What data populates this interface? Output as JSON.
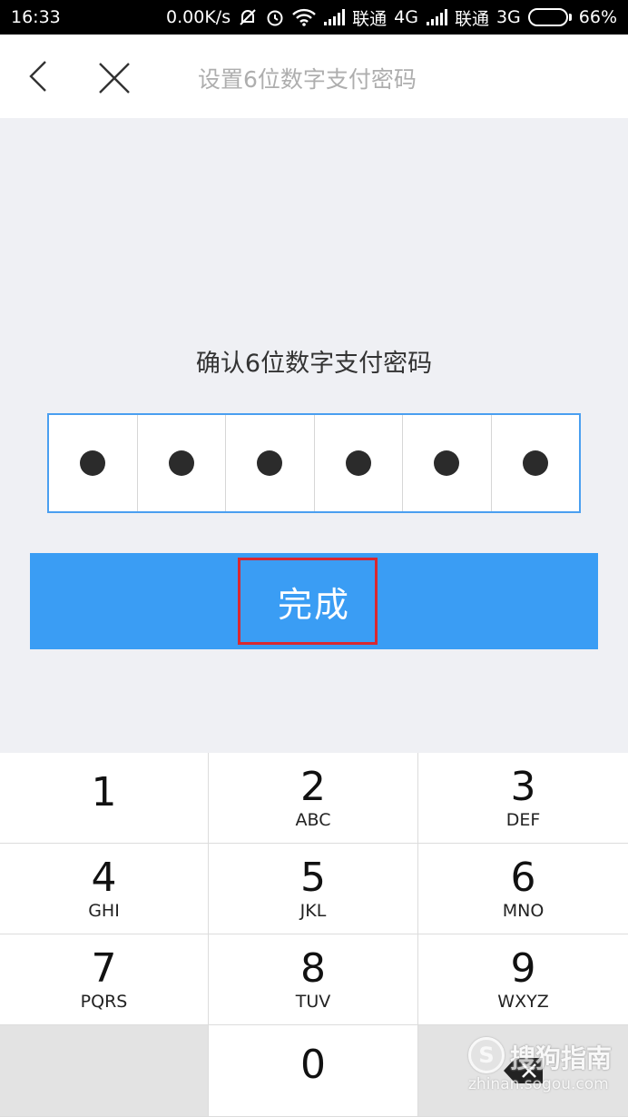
{
  "status_bar": {
    "time": "16:33",
    "net_speed": "0.00K/s",
    "carrier1": "联通",
    "net1": "4G",
    "carrier2": "联通",
    "net2": "3G",
    "battery_text": "66%",
    "battery_level": 0.66
  },
  "header": {
    "title": "设置6位数字支付密码",
    "back_icon": "chevron-left-icon",
    "close_icon": "close-icon"
  },
  "prompt": "确认6位数字支付密码",
  "pin": {
    "length": 6,
    "filled": 6
  },
  "done_button": {
    "label": "完成",
    "color": "#3a9df4",
    "highlight_color": "#d9282f"
  },
  "keypad": {
    "keys": [
      {
        "digit": "1",
        "letters": ""
      },
      {
        "digit": "2",
        "letters": "ABC"
      },
      {
        "digit": "3",
        "letters": "DEF"
      },
      {
        "digit": "4",
        "letters": "GHI"
      },
      {
        "digit": "5",
        "letters": "JKL"
      },
      {
        "digit": "6",
        "letters": "MNO"
      },
      {
        "digit": "7",
        "letters": "PQRS"
      },
      {
        "digit": "8",
        "letters": "TUV"
      },
      {
        "digit": "9",
        "letters": "WXYZ"
      },
      {
        "digit": "0",
        "letters": ""
      }
    ],
    "delete_icon": "backspace-icon"
  },
  "watermark": {
    "brand": "搜狗指南",
    "url": "zhinan.sogou.com"
  }
}
